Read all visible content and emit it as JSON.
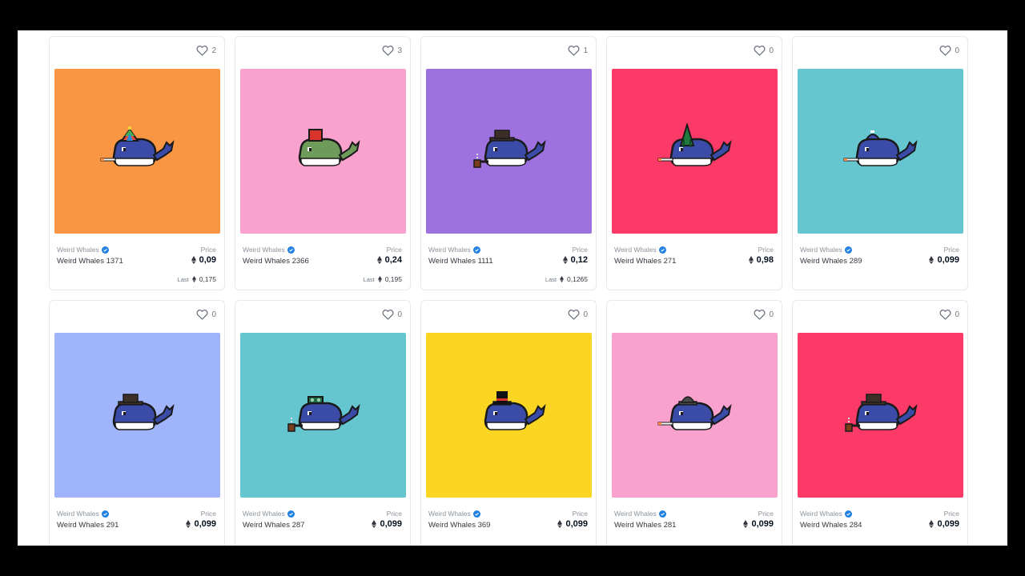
{
  "cards": [
    {
      "collection": "Weird Whales",
      "name": "Weird Whales 1371",
      "likes": "2",
      "price_label": "Price",
      "price": "0,09",
      "last_label": "Last",
      "last": "0,175",
      "bg": "#f99643",
      "hat": "propeller",
      "body": "#3a4ca8",
      "accessory": "cigarette"
    },
    {
      "collection": "Weird Whales",
      "name": "Weird Whales 2366",
      "likes": "3",
      "price_label": "Price",
      "price": "0,24",
      "last_label": "Last",
      "last": "0,195",
      "bg": "#f9a2ce",
      "hat": "fez",
      "body": "#6f9b5a",
      "accessory": "none"
    },
    {
      "collection": "Weird Whales",
      "name": "Weird Whales 1111",
      "likes": "1",
      "price_label": "Price",
      "price": "0,12",
      "last_label": "Last",
      "last": "0,1265",
      "bg": "#9d72df",
      "hat": "fedora",
      "body": "#3a4ca8",
      "accessory": "pipe"
    },
    {
      "collection": "Weird Whales",
      "name": "Weird Whales 271",
      "likes": "0",
      "price_label": "Price",
      "price": "0,98",
      "bg": "#fb3a68",
      "hat": "elf",
      "body": "#3a4ca8",
      "accessory": "cigarette"
    },
    {
      "collection": "Weird Whales",
      "name": "Weird Whales 289",
      "likes": "0",
      "price_label": "Price",
      "price": "0,099",
      "bg": "#66c6cf",
      "hat": "cap",
      "body": "#3a4ca8",
      "accessory": "cigarette"
    },
    {
      "collection": "Weird Whales",
      "name": "Weird Whales 291",
      "likes": "0",
      "price_label": "Price",
      "price": "0,099",
      "bg": "#a0b4fb",
      "hat": "fedora",
      "body": "#3a4ca8",
      "accessory": "none"
    },
    {
      "collection": "Weird Whales",
      "name": "Weird Whales 287",
      "likes": "0",
      "price_label": "Price",
      "price": "0,099",
      "bg": "#66c6cf",
      "hat": "goggles",
      "body": "#3a4ca8",
      "accessory": "pipe"
    },
    {
      "collection": "Weird Whales",
      "name": "Weird Whales 369",
      "likes": "0",
      "price_label": "Price",
      "price": "0,099",
      "bg": "#fad522",
      "hat": "tophat",
      "body": "#3a4ca8",
      "accessory": "none"
    },
    {
      "collection": "Weird Whales",
      "name": "Weird Whales 281",
      "likes": "0",
      "price_label": "Price",
      "price": "0,099",
      "bg": "#f9a2ce",
      "hat": "bowler",
      "body": "#3a4ca8",
      "accessory": "cigarette"
    },
    {
      "collection": "Weird Whales",
      "name": "Weird Whales 284",
      "likes": "0",
      "price_label": "Price",
      "price": "0,099",
      "bg": "#fb3a68",
      "hat": "fedora",
      "body": "#3a4ca8",
      "accessory": "pipe"
    }
  ]
}
